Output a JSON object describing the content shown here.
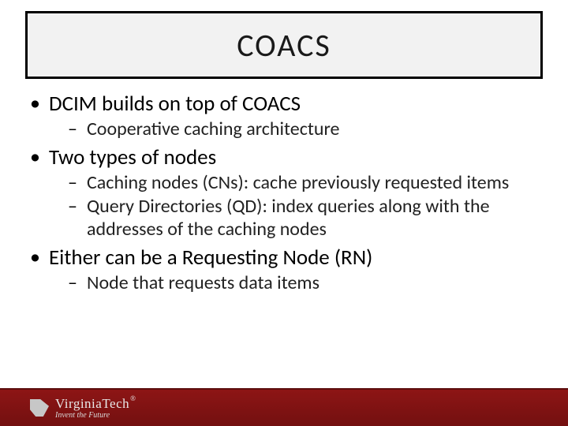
{
  "title": "COACS",
  "bullets": [
    {
      "text": "DCIM builds on top of COACS",
      "sub": [
        "Cooperative caching architecture"
      ]
    },
    {
      "text": "Two types of nodes",
      "sub": [
        "Caching nodes (CNs): cache previously requested items",
        "Query Directories (QD): index queries along with the addresses of the caching nodes"
      ]
    },
    {
      "text": "Either can be a Requesting Node (RN)",
      "sub": [
        "Node that requests data items"
      ]
    }
  ],
  "footer": {
    "brand": "VirginiaTech",
    "reg": "®",
    "tagline": "Invent the Future"
  }
}
